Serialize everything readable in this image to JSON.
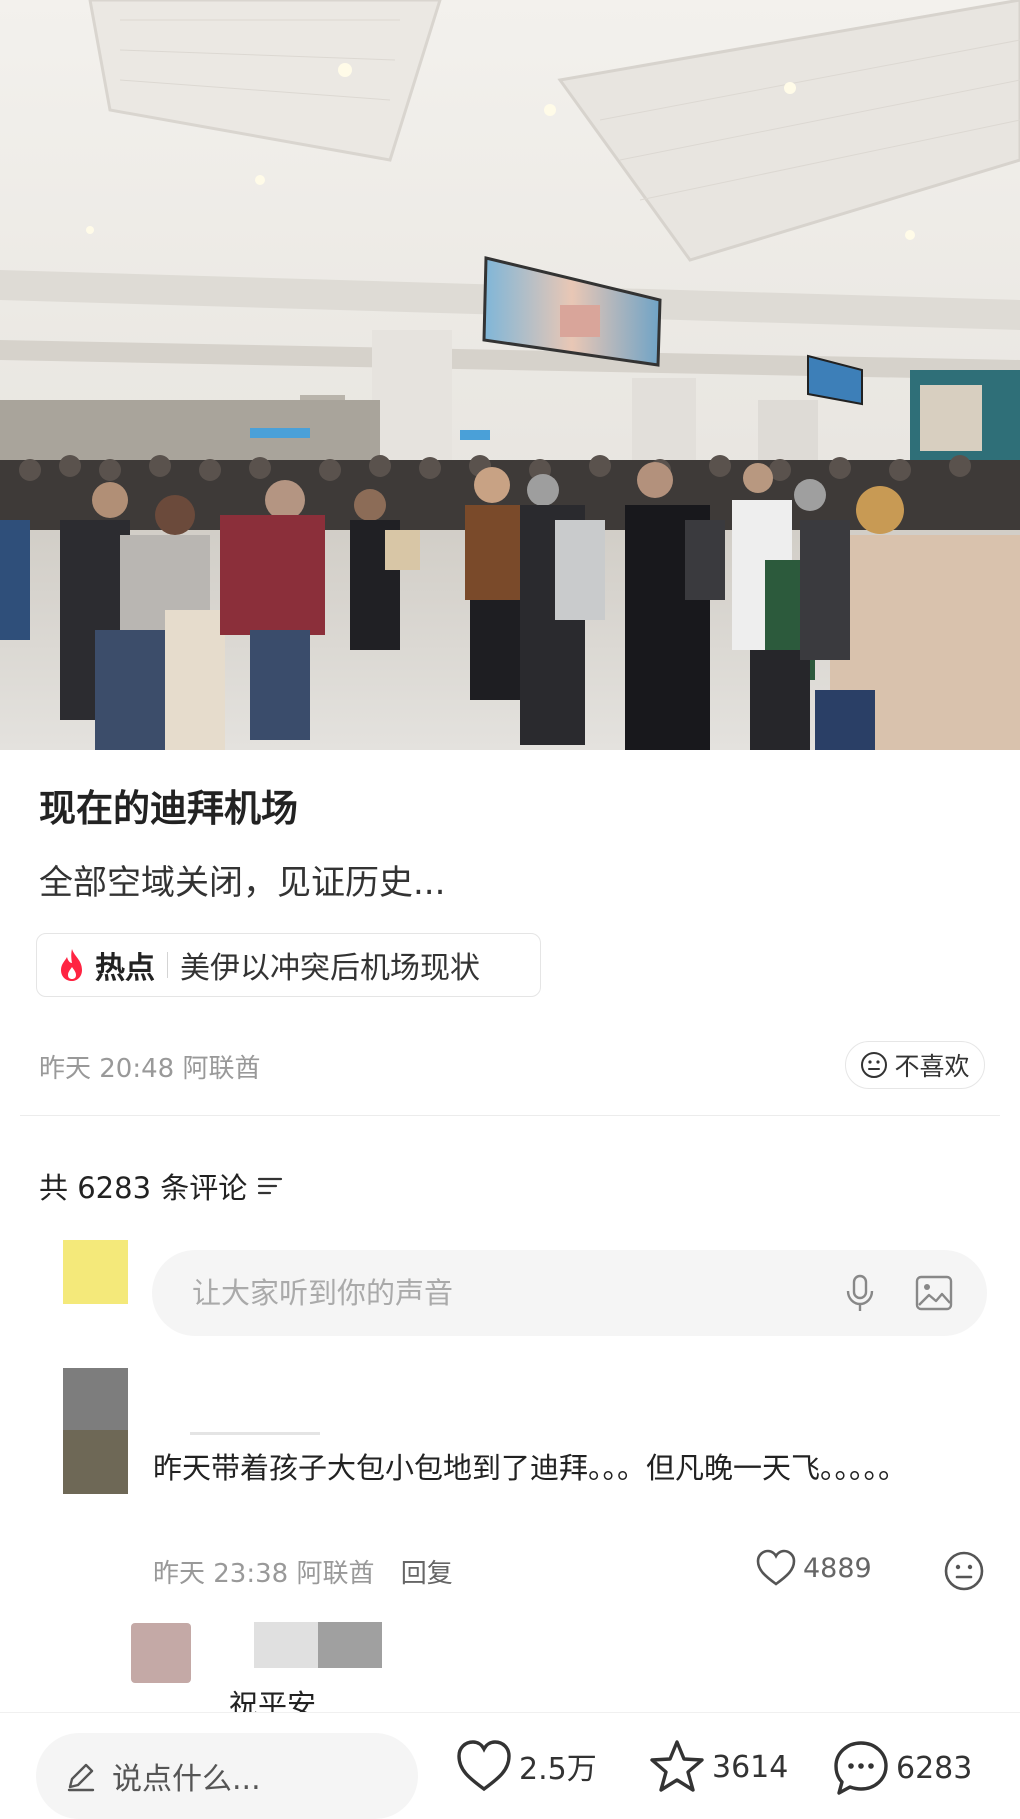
{
  "post": {
    "title": "现在的迪拜机场",
    "body": "全部空域关闭，见证历史...",
    "topic_badge": "热点",
    "topic_text": "美伊以冲突后机场现状",
    "time": "昨天 20:48",
    "location": "阿联酋",
    "dislike_label": "不喜欢"
  },
  "comments_section": {
    "count_label": "共 6283 条评论",
    "input_placeholder": "让大家听到你的声音"
  },
  "comment": {
    "text": "昨天带着孩子大包小包地到了迪拜。。。但凡晚一天飞。。。。。",
    "time": "昨天 23:38",
    "location": "阿联酋",
    "reply_label": "回复",
    "likes": "4889"
  },
  "reply": {
    "text": "祝平安"
  },
  "bottom_bar": {
    "input_placeholder": "说点什么...",
    "likes": "2.5万",
    "favorites": "3614",
    "comments": "6283"
  },
  "icons": [
    "mic-icon",
    "image-icon",
    "flame-icon",
    "neutral-face-icon",
    "heart-icon",
    "star-icon",
    "chat-icon",
    "pencil-icon",
    "sort-icon"
  ],
  "colors": {
    "hot": "#ff2442",
    "muted": "#999999"
  }
}
